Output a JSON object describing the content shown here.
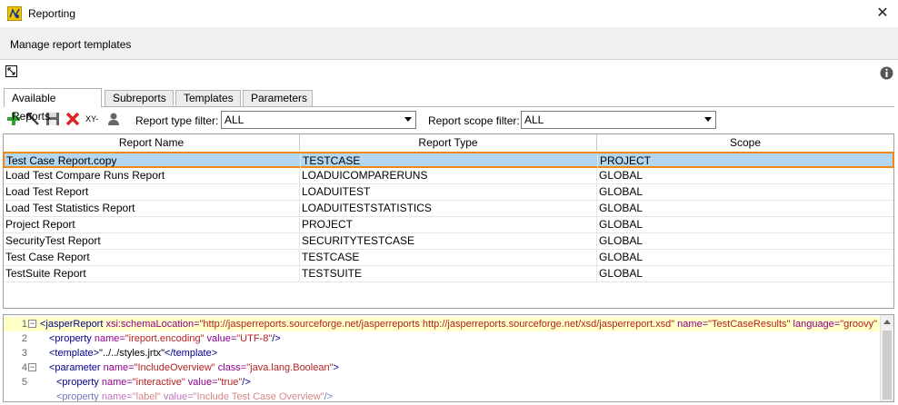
{
  "window": {
    "title": "Reporting",
    "close_glyph": "✕"
  },
  "banner": {
    "text": "Manage report templates"
  },
  "tabs": [
    {
      "label": "Available Reports",
      "active": true
    },
    {
      "label": "Subreports",
      "active": false
    },
    {
      "label": "Templates",
      "active": false
    },
    {
      "label": "Parameters",
      "active": false
    }
  ],
  "toolbar": {
    "xy_label": "XY-",
    "type_filter_label": "Report type filter:",
    "type_filter_value": "ALL",
    "scope_filter_label": "Report scope filter:",
    "scope_filter_value": "ALL"
  },
  "table": {
    "columns": [
      "Report Name",
      "Report Type",
      "Scope"
    ],
    "rows": [
      [
        "Test Case Report.copy",
        "TESTCASE",
        "PROJECT"
      ],
      [
        "Load Test Compare Runs Report",
        "LOADUICOMPARERUNS",
        "GLOBAL"
      ],
      [
        "Load Test Report",
        "LOADUITEST",
        "GLOBAL"
      ],
      [
        "Load Test Statistics Report",
        "LOADUITESTSTATISTICS",
        "GLOBAL"
      ],
      [
        "Project Report",
        "PROJECT",
        "GLOBAL"
      ],
      [
        "SecurityTest Report",
        "SECURITYTESTCASE",
        "GLOBAL"
      ],
      [
        "Test Case Report",
        "TESTCASE",
        "GLOBAL"
      ],
      [
        "TestSuite Report",
        "TESTSUITE",
        "GLOBAL"
      ]
    ],
    "selected_row": 0
  },
  "editor": {
    "lines": [
      {
        "n": "1",
        "fold": "−",
        "indent": 0
      },
      {
        "n": "2",
        "fold": "",
        "indent": 1
      },
      {
        "n": "3",
        "fold": "",
        "indent": 1
      },
      {
        "n": "4",
        "fold": "−",
        "indent": 1
      },
      {
        "n": "5",
        "fold": "",
        "indent": 2
      },
      {
        "n": "",
        "fold": "",
        "indent": 2
      }
    ],
    "line1": {
      "open": "<jasperReport",
      "a1": " xsi:schemaLocation=",
      "v1": "\"http://jasperreports.sourceforge.net/jasperreports http://jasperreports.sourceforge.net/xsd/jasperreport.xsd\"",
      "a2": " name=",
      "v2": "\"TestCaseResults\"",
      "a3": " language=",
      "v3": "\"groovy\""
    },
    "line2": {
      "open": "<property",
      "a1": " name=",
      "v1": "\"ireport.encoding\"",
      "a2": " value=",
      "v2": "\"UTF-8\"",
      "close": "/>"
    },
    "line3": {
      "open": "<template>",
      "text": "\"../../styles.jrtx\"",
      "close": "</template>"
    },
    "line4": {
      "open": "<parameter",
      "a1": " name=",
      "v1": "\"IncludeOverview\"",
      "a2": " class=",
      "v2": "\"java.lang.Boolean\"",
      "close": ">"
    },
    "line5": {
      "open": "<property",
      "a1": " name=",
      "v1": "\"interactive\"",
      "a2": " value=",
      "v2": "\"true\"",
      "close": "/>"
    },
    "line6": {
      "open": "<property",
      "a1": " name=",
      "v1": "\"label\"",
      "a2": " value=",
      "v2": "\"Include Test Case Overview\"",
      "close": "/>"
    }
  },
  "colors": {
    "accent_selection": "#b3d7f3",
    "selection_border": "#f0871b",
    "add_green": "#2fa52f",
    "delete_red": "#e02020"
  },
  "icons": [
    "app-icon",
    "close-icon",
    "maximize-icon",
    "info-icon",
    "add-icon",
    "edit-icon",
    "save-icon",
    "delete-icon",
    "user-icon",
    "chevron-down-icon"
  ]
}
